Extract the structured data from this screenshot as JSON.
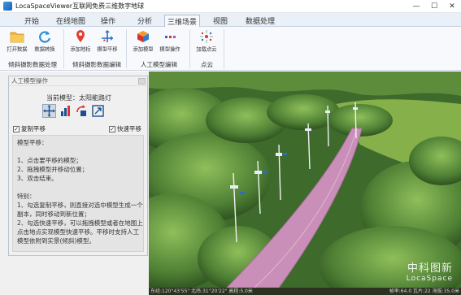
{
  "app": {
    "title": "LocaSpaceViewer互联网免费三维数字地球"
  },
  "window_controls": {
    "minimize": "—",
    "maximize": "☐",
    "close": "✕"
  },
  "menu": {
    "tabs": [
      "开始",
      "在线地图",
      "操作",
      "分析",
      "三维场景",
      "视图",
      "数据处理"
    ],
    "active_index": 4
  },
  "ribbon": {
    "buttons": [
      "打开数据",
      "数据转换",
      "添加地标",
      "模型平移",
      "添加模型",
      "模型操作",
      "加载点云"
    ],
    "groups": [
      "倾斜摄影数据处理",
      "倾斜摄影数据编辑",
      "人工模型编辑",
      "点云"
    ]
  },
  "panel": {
    "title": "人工模型操作",
    "current_model_label": "当前模型：",
    "current_model_value": "太阳能路灯",
    "copy_translate": {
      "label": "复制平移",
      "checked": true
    },
    "quick_translate": {
      "label": "快速平移",
      "checked": true
    },
    "help_lines": [
      "模型平移：",
      "",
      "1、点击要平移的模型；",
      "2、拖拽模型并移动位置；",
      "3、双击结束。",
      "",
      "特别：",
      "1、勾选复制平移，则直接对选中模型生成一个",
      "副本，同时移动到新位置；",
      "2、勾选快速平移，可以拖拽模型或者在地图上",
      "点击地点实现模型快速平移。平移时支持人工",
      "模型依附到实景(倾斜)模型。"
    ]
  },
  "viewport": {
    "watermark_cn": "中科图新",
    "watermark_en": "LocaSpace"
  },
  "status": {
    "left": "东经:120°43'55\"  北纬:31°20'22\"  高程:5.0米",
    "right": "帧率:64.0  瓦片:22  海拔:35.0米"
  },
  "colors": {
    "accent": "#1d62b5",
    "foliage": "#3d6b2d",
    "path": "#c98fb8"
  }
}
